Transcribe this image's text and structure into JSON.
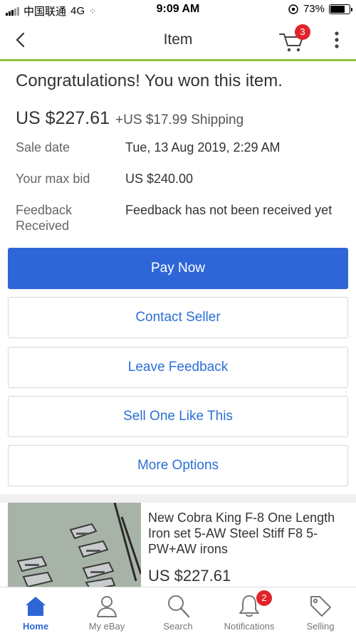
{
  "status_bar": {
    "carrier": "中国联通",
    "network": "4G",
    "time": "9:09 AM",
    "battery": "73%",
    "battery_level": 0.73
  },
  "nav": {
    "title": "Item",
    "cart_count": "3",
    "back_icon": "chevron-left-icon",
    "cart_icon": "cart-icon",
    "more_icon": "vertical-ellipsis-icon"
  },
  "summary": {
    "message": "Congratulations! You won this item.",
    "price": "US $227.61",
    "shipping": "+US $17.99 Shipping"
  },
  "details": [
    {
      "label": "Sale date",
      "value": "Tue, 13 Aug 2019, 2:29 AM"
    },
    {
      "label": "Your max bid",
      "value": "US $240.00"
    },
    {
      "label": "Feedback Received",
      "value": "Feedback has not been received yet"
    }
  ],
  "actions": {
    "pay_now": "Pay Now",
    "contact_seller": "Contact Seller",
    "leave_feedback": "Leave Feedback",
    "sell_one_like_this": "Sell One Like This",
    "more_options": "More Options"
  },
  "item": {
    "title": "New Cobra King F-8 One Length Iron set 5-AW Steel Stiff F8 5-PW+AW irons",
    "price": "US $227.61"
  },
  "tabs": [
    {
      "label": "Home",
      "icon": "home-icon",
      "active": true
    },
    {
      "label": "My eBay",
      "icon": "person-icon",
      "active": false
    },
    {
      "label": "Search",
      "icon": "search-icon",
      "active": false
    },
    {
      "label": "Notifications",
      "icon": "bell-icon",
      "active": false,
      "badge": "2"
    },
    {
      "label": "Selling",
      "icon": "tag-icon",
      "active": false
    }
  ],
  "colors": {
    "accent": "#2e66d7",
    "header_border": "#8bc53f",
    "badge": "#e0242c"
  }
}
